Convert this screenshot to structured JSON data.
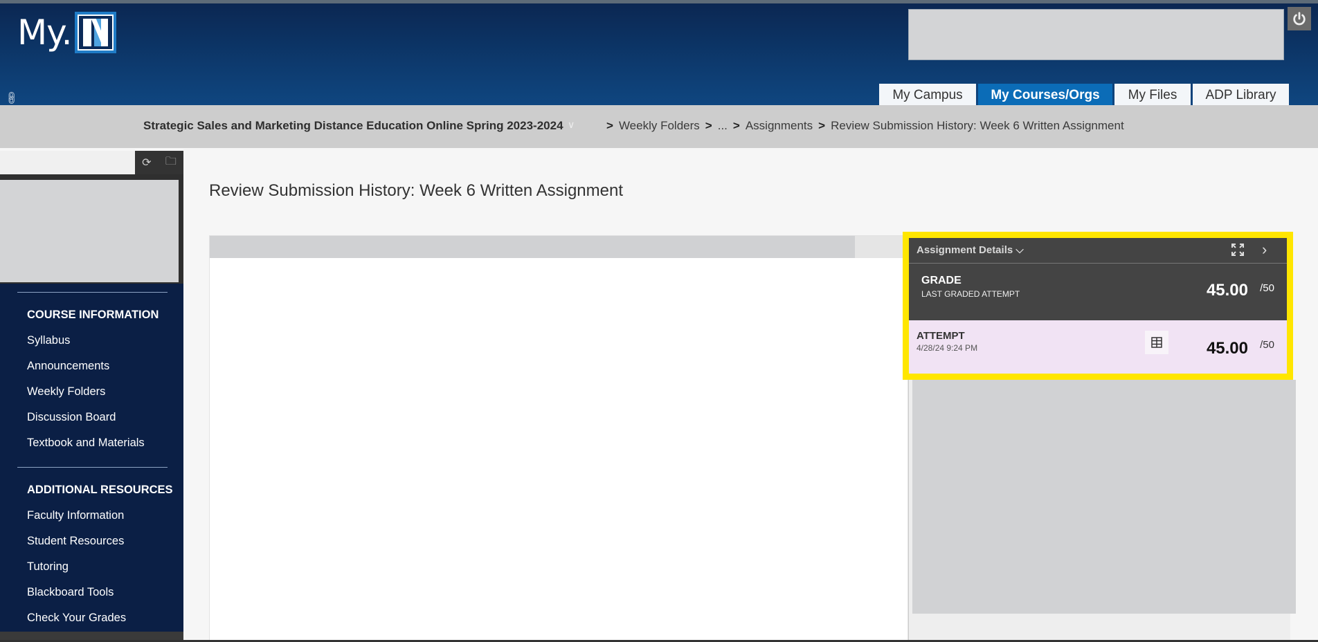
{
  "header": {
    "logo_text": "My.",
    "logo_letter": "N",
    "tabs": [
      {
        "label": "My Campus",
        "active": false
      },
      {
        "label": "My Courses/Orgs",
        "active": true
      },
      {
        "label": "My Files",
        "active": false
      },
      {
        "label": "ADP Library",
        "active": false
      }
    ],
    "icons": {
      "link": "link-icon",
      "power": "power-icon"
    }
  },
  "breadcrumb": {
    "course": "Strategic Sales and Marketing Distance Education Online Spring 2023-2024",
    "items": [
      "Weekly Folders",
      "...",
      "Assignments",
      "Review Submission History: Week 6 Written Assignment"
    ],
    "separator": ">"
  },
  "sidebar": {
    "tools": {
      "refresh": "refresh-icon",
      "folder": "folder-icon"
    },
    "sections": [
      {
        "heading": "COURSE INFORMATION",
        "items": [
          "Syllabus",
          "Announcements",
          "Weekly Folders",
          "Discussion Board",
          "Textbook and Materials"
        ]
      },
      {
        "heading": "ADDITIONAL RESOURCES",
        "items": [
          "Faculty Information",
          "Student Resources",
          "Tutoring",
          "Blackboard Tools",
          "Check Your Grades"
        ]
      }
    ]
  },
  "main": {
    "title": "Review Submission History: Week 6 Written Assignment"
  },
  "assignment_details": {
    "title": "Assignment Details",
    "grade": {
      "label": "GRADE",
      "sublabel": "LAST GRADED ATTEMPT",
      "score": "45.00",
      "max": "/50"
    },
    "attempt": {
      "label": "ATTEMPT",
      "date": "4/28/24 9:24 PM",
      "score": "45.00",
      "max": "/50"
    },
    "colors": {
      "highlight": "#ffe600",
      "panel": "#444444",
      "attempt_bg": "#f1e3f4"
    }
  }
}
